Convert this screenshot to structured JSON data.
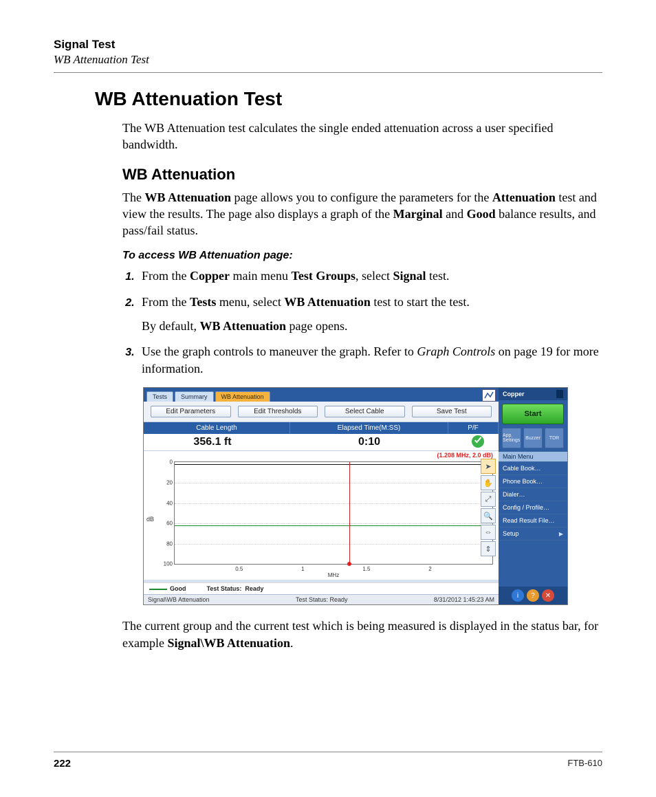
{
  "header": {
    "title": "Signal Test",
    "subtitle": "WB Attenuation Test"
  },
  "section": {
    "title": "WB Attenuation Test",
    "intro": "The WB Attenuation test calculates the single ended attenuation across a user specified bandwidth.",
    "sub_title": "WB Attenuation",
    "sub_para_pre": "The ",
    "sub_para_b1": "WB Attenuation",
    "sub_para_mid1": " page allows you to configure the parameters for the ",
    "sub_para_b2": "Attenuation",
    "sub_para_mid2": " test and view the results. The page also displays a graph of the ",
    "sub_para_b3": "Marginal",
    "sub_para_mid3": " and ",
    "sub_para_b4": "Good",
    "sub_para_end": " balance results, and pass/fail status.",
    "proc_head": "To access WB Attenuation page:",
    "steps": {
      "s1_pre": "From the ",
      "s1_b1": "Copper",
      "s1_mid1": " main menu ",
      "s1_b2": "Test Groups",
      "s1_mid2": ", select ",
      "s1_b3": "Signal",
      "s1_end": " test.",
      "s2_pre": "From the ",
      "s2_b1": "Tests",
      "s2_mid1": " menu, select ",
      "s2_b2": "WB Attenuation",
      "s2_end": " test to start the test.",
      "s2_extra_pre": "By default, ",
      "s2_extra_b": "WB Attenuation",
      "s2_extra_end": " page opens.",
      "s3_pre": "Use the graph controls to maneuver the graph. Refer to ",
      "s3_i": "Graph Controls",
      "s3_end": " on page 19 for more information."
    },
    "after_shot_pre": "The current group and the current test which is being measured is displayed in the status bar, for example ",
    "after_shot_b": "Signal\\WB Attenuation",
    "after_shot_end": "."
  },
  "screenshot": {
    "tabs": [
      "Tests",
      "Summary",
      "WB Attenuation"
    ],
    "active_tab_index": 2,
    "buttons": [
      "Edit Parameters",
      "Edit Thresholds",
      "Select Cable",
      "Save Test"
    ],
    "headers": {
      "cable": "Cable Length",
      "time": "Elapsed Time(M:SS)",
      "pf": "P/F"
    },
    "values": {
      "cable": "356.1 ft",
      "time": "0:10"
    },
    "annotation": "(1.208 MHz, 2.0 dB)",
    "ylabel": "dB",
    "xlabel": "MHz",
    "legend_good": "Good",
    "legend_status_label": "Test Status:",
    "legend_status_value": "Ready",
    "status_left": "Signal\\WB Attenuation",
    "status_center": "Test Status: Ready",
    "status_right": "8/31/2012 1:45:23 AM",
    "side_title": "Copper",
    "start_label": "Start",
    "side_tools": [
      "App. Settings",
      "Buzzer",
      "TDR"
    ],
    "menu_head": "Main Menu",
    "menu_items": [
      "Cable Book…",
      "Phone Book…",
      "Dialer…",
      "Config / Profile…",
      "Read Result File…",
      "Setup"
    ]
  },
  "chart_data": {
    "type": "line",
    "title": "",
    "xlabel": "MHz",
    "ylabel": "dB",
    "xlim": [
      0,
      2.2
    ],
    "ylim": [
      100,
      0
    ],
    "xticks": [
      0.5,
      1.0,
      1.5,
      2.0
    ],
    "yticks": [
      0.0,
      20.0,
      40.0,
      60.0,
      80.0,
      100.0
    ],
    "cursor": {
      "x": 1.208,
      "y": 2.0
    },
    "series": [
      {
        "name": "Attenuation",
        "color": "#111111",
        "approx_constant_y": 2.0
      },
      {
        "name": "Good",
        "color": "#1f8a30",
        "approx_constant_y": 62.0
      }
    ]
  },
  "footer": {
    "page": "222",
    "doc": "FTB-610"
  }
}
